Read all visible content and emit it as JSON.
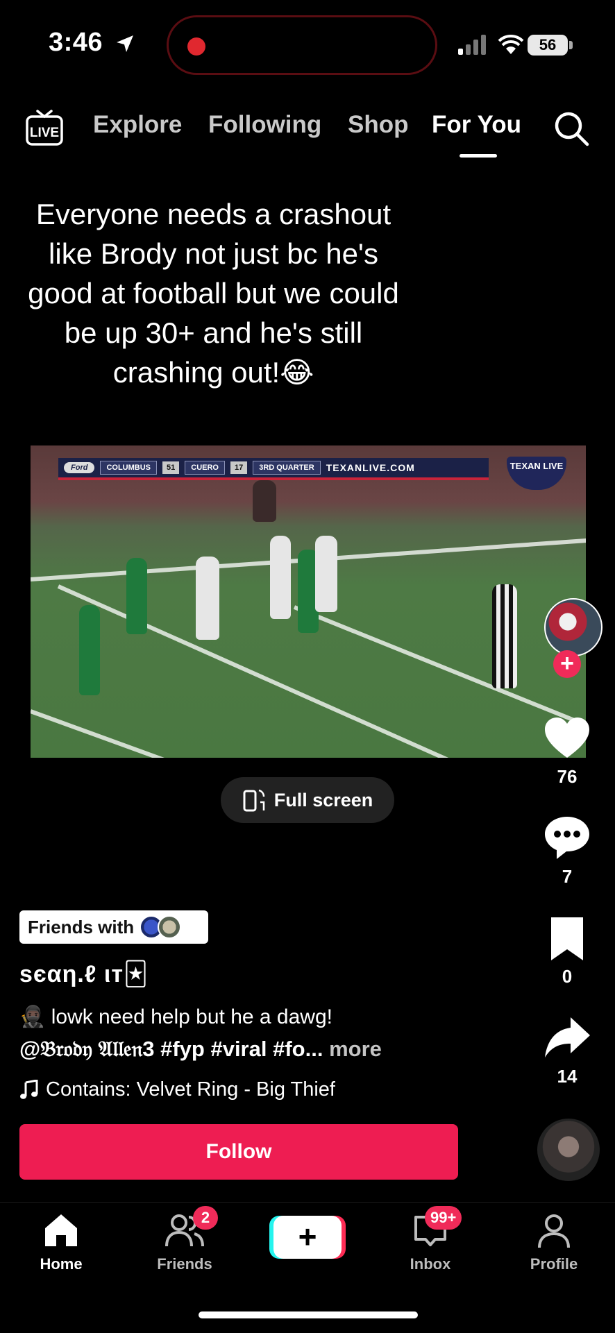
{
  "status_bar": {
    "time": "3:46",
    "battery": "56"
  },
  "top_nav": {
    "live_label": "LIVE",
    "tabs": [
      {
        "label": "Explore"
      },
      {
        "label": "Following"
      },
      {
        "label": "Shop"
      },
      {
        "label": "For You"
      }
    ],
    "active_tab": "For You"
  },
  "post": {
    "overlay_text": "Everyone needs a crashout like Brody not just bc he's good at football but we could be up 30+ and he's still crashing out!😂",
    "video": {
      "scorebar": {
        "logo": "Ford",
        "team1": "COLUMBUS",
        "score1": "51",
        "team2": "CUERO",
        "score2": "17",
        "period": "3RD QUARTER",
        "site": "TEXANLIVE.COM"
      },
      "badge": "TEXAN LIVE"
    },
    "full_screen_label": "Full screen",
    "friends_with_label": "Friends with",
    "username": "sєαη.ℓ ιт🃏",
    "description_line1": "🥷🏿 lowk need help but he a dawg!",
    "description_line2": "@𝔅𝔯𝔬𝔡𝔶 𝔄𝔩𝔩𝔢𝔫3 #fyp #viral #fo...",
    "more_label": "more",
    "music": "Contains: Velvet Ring - Big Thief",
    "follow_label": "Follow"
  },
  "rail": {
    "likes": "76",
    "comments": "7",
    "saves": "0",
    "shares": "14"
  },
  "bottom_tabs": {
    "home": "Home",
    "friends": "Friends",
    "friends_badge": "2",
    "inbox": "Inbox",
    "inbox_badge": "99+",
    "profile": "Profile",
    "create": "+"
  },
  "colors": {
    "accent": "#ee1d52",
    "background": "#000000"
  }
}
